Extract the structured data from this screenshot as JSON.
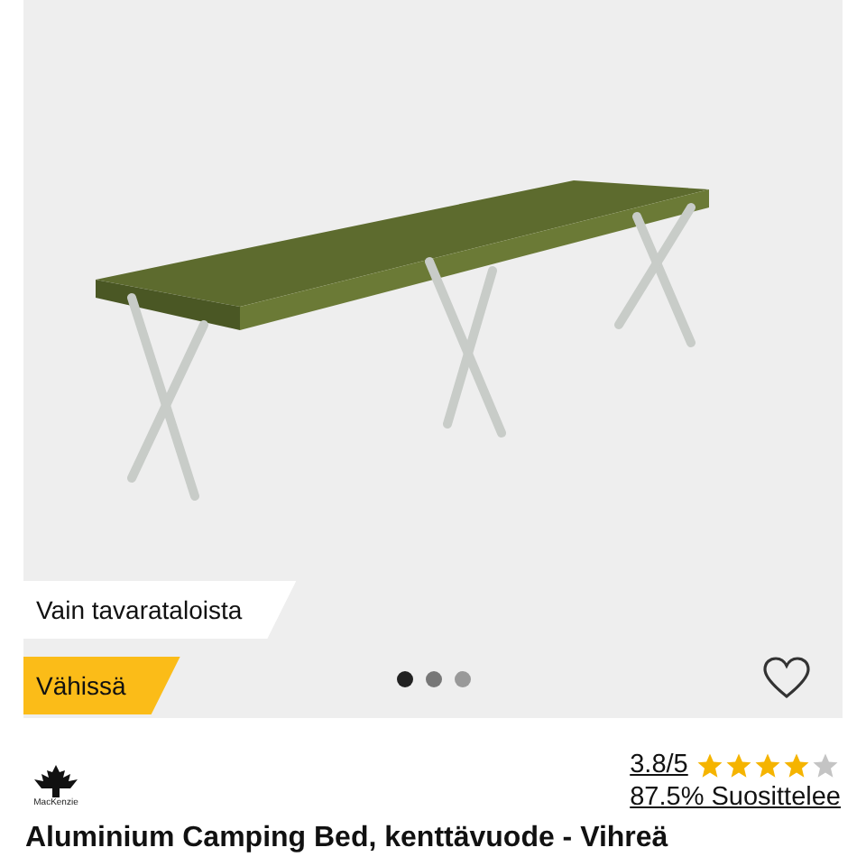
{
  "gallery": {
    "badges": [
      {
        "kind": "plain",
        "label": "Vain tavarataloista"
      },
      {
        "kind": "highlight",
        "label": "Vähissä"
      }
    ],
    "dots": [
      {
        "selected": true
      },
      {
        "selected": false
      },
      {
        "selected": false
      }
    ],
    "favorite": {
      "selected": false
    }
  },
  "brand": {
    "name": "MacKenzie"
  },
  "rating": {
    "score": "3.8/5",
    "stars": 4,
    "recommend": "87.5% Suosittelee"
  },
  "title": "Aluminium Camping Bed, kenttävuode - Vihreä"
}
